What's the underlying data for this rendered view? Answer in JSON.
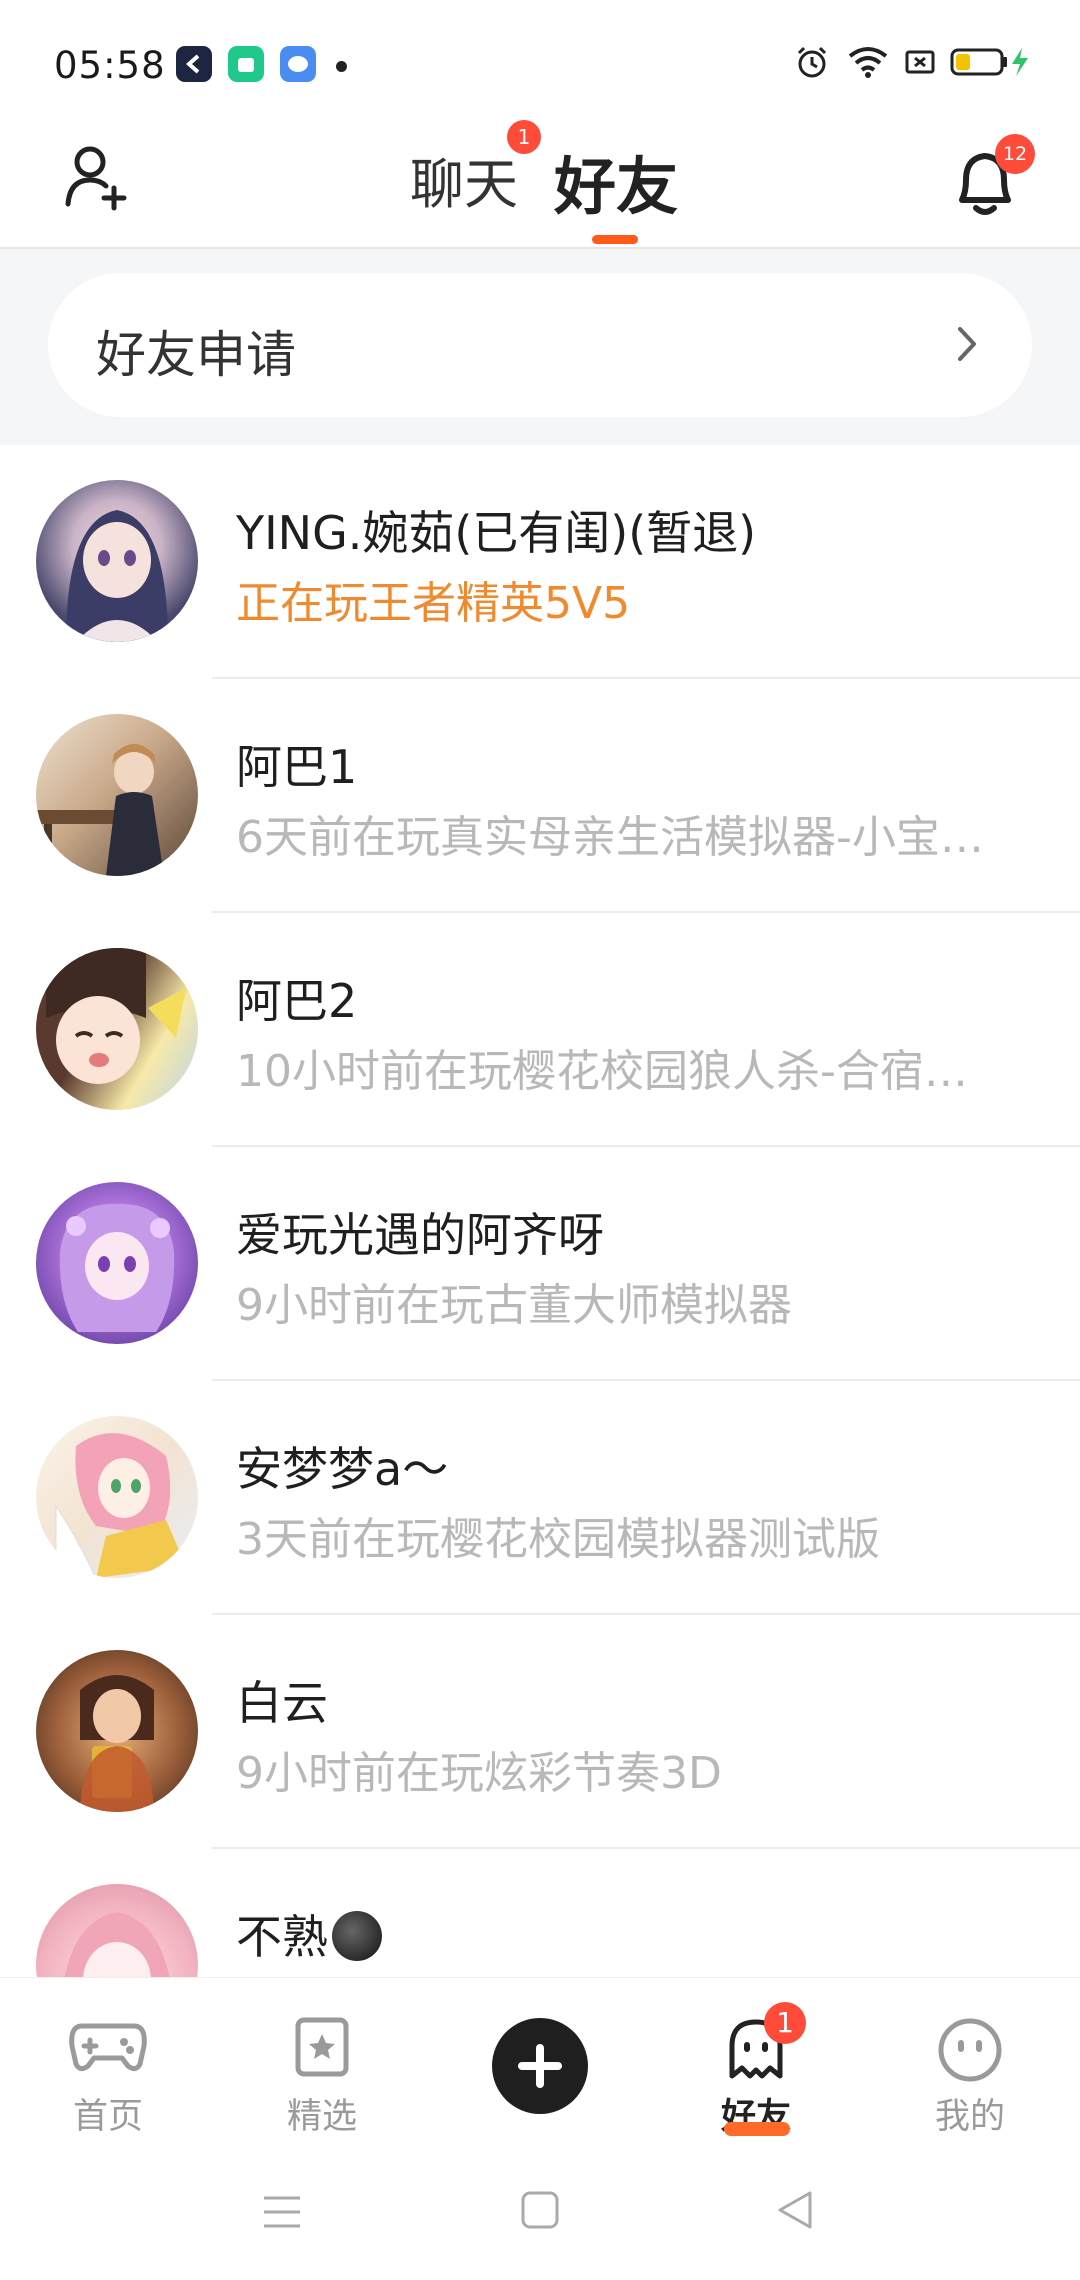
{
  "status_bar": {
    "time": "05:58"
  },
  "header": {
    "tab_chat": "聊天",
    "tab_chat_badge": "1",
    "tab_friends": "好友",
    "notification_count": "12"
  },
  "friend_request": {
    "label": "好友申请"
  },
  "friends": [
    {
      "name": "YING.婉茹(已有闺)(暂退)",
      "status": "正在玩王者精英5V5",
      "active": true
    },
    {
      "name": "阿巴1",
      "status": "6天前在玩真实母亲生活模拟器-小宝…",
      "active": false
    },
    {
      "name": "阿巴2",
      "status": "10小时前在玩樱花校园狼人杀-合宿…",
      "active": false
    },
    {
      "name": "爱玩光遇的阿齐呀",
      "status": "9小时前在玩古董大师模拟器",
      "active": false
    },
    {
      "name": "安梦梦a～",
      "status": "3天前在玩樱花校园模拟器测试版",
      "active": false
    },
    {
      "name": "白云",
      "status": "9小时前在玩炫彩节奏3D",
      "active": false
    },
    {
      "name": "不熟",
      "status": "",
      "active": false
    }
  ],
  "bottom_nav": {
    "home": "首页",
    "featured": "精选",
    "friends": "好友",
    "friends_badge": "1",
    "mine": "我的"
  },
  "colors": {
    "accent": "#ff5a1a",
    "active_status": "#f08a2e",
    "badge": "#ff4b3a"
  }
}
